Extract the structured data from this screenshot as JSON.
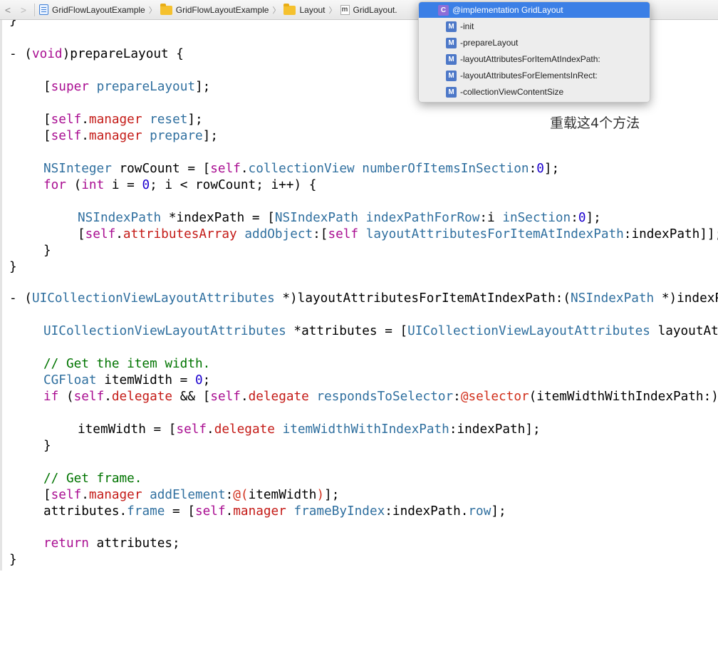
{
  "jumpbar": {
    "back": "<",
    "forward": ">",
    "crumbs": [
      "GridFlowLayoutExample",
      "GridFlowLayoutExample",
      "Layout",
      "GridLayout."
    ]
  },
  "popup": {
    "header": {
      "badge": "C",
      "label": "@implementation GridLayout"
    },
    "items": [
      {
        "badge": "M",
        "label": "-init"
      },
      {
        "badge": "M",
        "label": "-prepareLayout"
      },
      {
        "badge": "M",
        "label": "-layoutAttributesForItemAtIndexPath:"
      },
      {
        "badge": "M",
        "label": "-layoutAttributesForElementsInRect:"
      },
      {
        "badge": "M",
        "label": "-collectionViewContentSize"
      }
    ]
  },
  "annotation": "重载这4个方法",
  "code": {
    "top_brace": "}",
    "l1_a": "- (",
    "l1_kw": "void",
    "l1_b": ")prepareLayout {",
    "l2_a": "[",
    "l2_kw": "super",
    "l2_m": "prepareLayout",
    "l2_b": "];",
    "l3_a": "[",
    "l3_self": "self",
    "l3_dot": ".",
    "l3_prop": "manager",
    "l3_m": "reset",
    "l3_b": "];",
    "l4_a": "[",
    "l4_self": "self",
    "l4_dot": ".",
    "l4_prop": "manager",
    "l4_m": "prepare",
    "l4_b": "];",
    "l5_t": "NSInteger",
    "l5_a": " rowCount = [",
    "l5_self": "self",
    "l5_dot": ".",
    "l5_prop": "collectionView",
    "l5_m": "numberOfItemsInSection",
    "l5_c": ":",
    "l5_n": "0",
    "l5_b": "];",
    "l6_kw": "for",
    "l6_a": " (",
    "l6_t": "int",
    "l6_b": " i = ",
    "l6_n": "0",
    "l6_c": "; i < rowCount; i++) {",
    "l7_t": "NSIndexPath",
    "l7_a": " *indexPath = [",
    "l7_cls": "NSIndexPath",
    "l7_m1": "indexPathForRow",
    "l7_b": ":i ",
    "l7_m2": "inSection",
    "l7_c": ":",
    "l7_n": "0",
    "l7_d": "];",
    "l8_a": "[",
    "l8_self": "self",
    "l8_dot": ".",
    "l8_prop": "attributesArray",
    "l8_m": "addObject",
    "l8_b": ":[",
    "l8_self2": "self",
    "l8_m2": "layoutAttributesForItemAtIndexPath",
    "l8_c": ":indexPath]];",
    "l9": "}",
    "l10": "}",
    "l11_a": "- (",
    "l11_t": "UICollectionViewLayoutAttributes",
    "l11_b": " *)layoutAttributesForItemAtIndexPath:(",
    "l11_t2": "NSIndexPath",
    "l11_c": " *)indexPath {",
    "l12_t": "UICollectionViewLayoutAttributes",
    "l12_a": " *attributes = [",
    "l12_cls": "UICollectionViewLayoutAttributes",
    "l12_b": " layoutAttributesForCellWithIndexPath:indexPath];",
    "l13": "// Get the item width.",
    "l14_t": "CGFloat",
    "l14_a": " itemWidth = ",
    "l14_n": "0",
    "l14_b": ";",
    "l15_kw": "if",
    "l15_a": " (",
    "l15_self": "self",
    "l15_dot": ".",
    "l15_prop": "delegate",
    "l15_b": " && [",
    "l15_self2": "self",
    "l15_dot2": ".",
    "l15_prop2": "delegate",
    "l15_m": "respondsToSelector",
    "l15_c": ":",
    "l15_at": "@selector",
    "l15_d": "(itemWidthWithIndexPath:)]) {",
    "l16_a": "itemWidth = [",
    "l16_self": "self",
    "l16_dot": ".",
    "l16_prop": "delegate",
    "l16_m": "itemWidthWithIndexPath",
    "l16_b": ":indexPath];",
    "l17": "}",
    "l18": "// Get frame.",
    "l19_a": "[",
    "l19_self": "self",
    "l19_dot": ".",
    "l19_prop": "manager",
    "l19_m": "addElement",
    "l19_b": ":",
    "l19_at": "@(",
    "l19_c": "itemWidth",
    "l19_at2": ")",
    "l19_d": "];",
    "l20_a": "attributes.",
    "l20_prop": "frame",
    "l20_b": " = [",
    "l20_self": "self",
    "l20_dot": ".",
    "l20_prop2": "manager",
    "l20_m": "frameByIndex",
    "l20_c": ":indexPath.",
    "l20_row": "row",
    "l20_d": "];",
    "l21_kw": "return",
    "l21_a": " attributes;",
    "l22": "}"
  }
}
